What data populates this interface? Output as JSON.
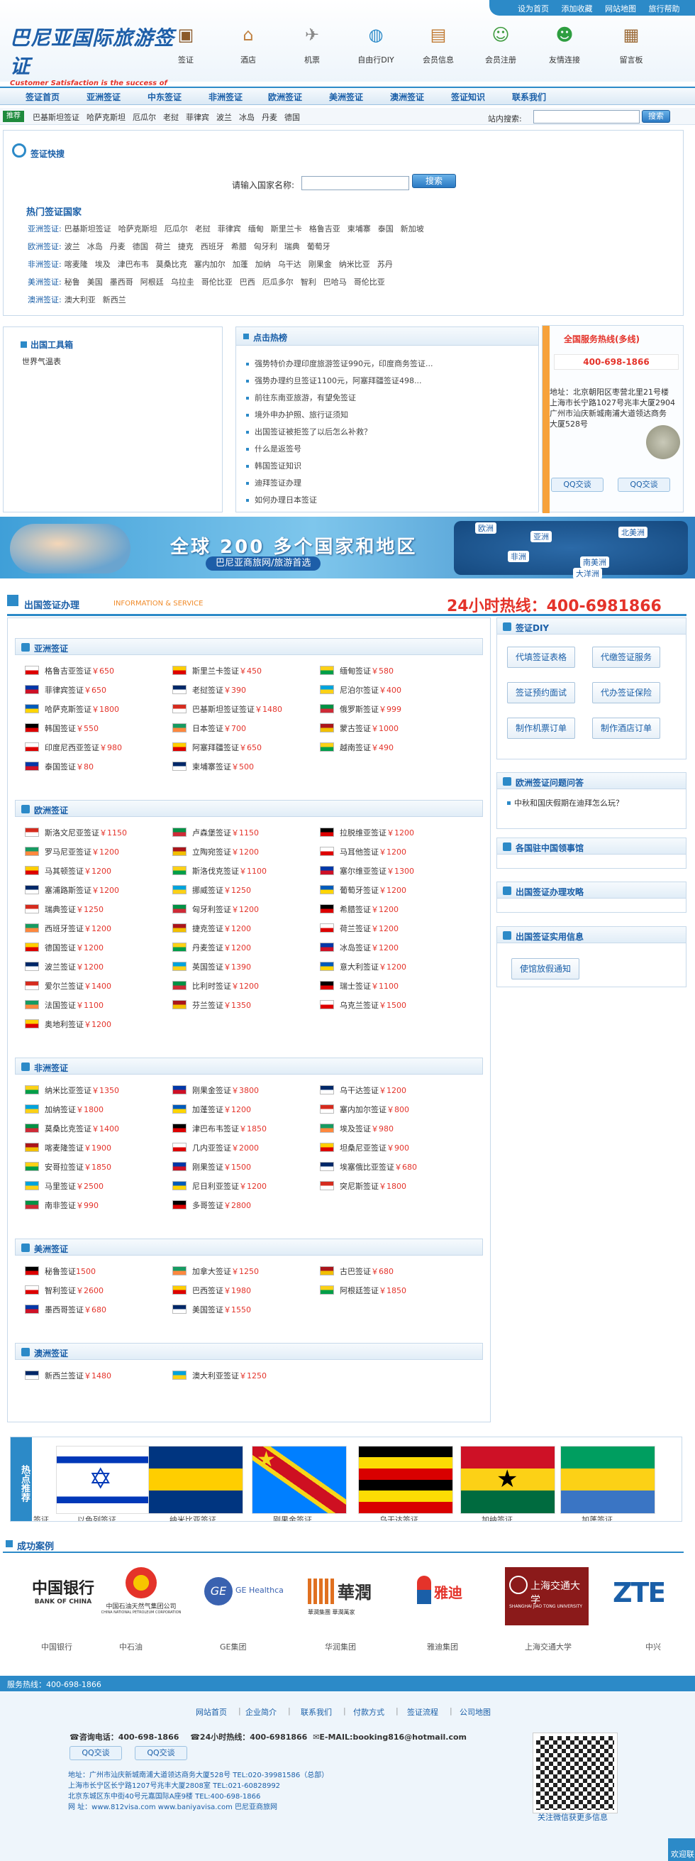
{
  "top_links": [
    "设为首页",
    "添加收藏",
    "网站地图",
    "旅行帮助"
  ],
  "logo": {
    "title": "巴尼亚国际旅游签证",
    "slogan": "Customer Satisfaction is the success of our business"
  },
  "top_icons": [
    {
      "label": "签证",
      "icon": "passport-icon",
      "color": "#8b5a2b",
      "glyph": "▣"
    },
    {
      "label": "酒店",
      "icon": "house-icon",
      "color": "#c08040",
      "glyph": "⌂"
    },
    {
      "label": "机票",
      "icon": "airplane-icon",
      "color": "#888888",
      "glyph": "✈"
    },
    {
      "label": "自由行DIY",
      "icon": "globe-icon",
      "color": "#2c8ac8",
      "glyph": "◍"
    },
    {
      "label": "会员信息",
      "icon": "sign-icon",
      "color": "#c07830",
      "glyph": "▤"
    },
    {
      "label": "会员注册",
      "icon": "user-add-icon",
      "color": "#3c9a3c",
      "glyph": "☺"
    },
    {
      "label": "友情连接",
      "icon": "people-icon",
      "color": "#2e9e40",
      "glyph": "☻"
    },
    {
      "label": "留言板",
      "icon": "board-icon",
      "color": "#9c6a36",
      "glyph": "▦"
    }
  ],
  "nav": [
    "签证首页",
    "亚洲签证",
    "中东签证",
    "非洲签证",
    "欧洲签证",
    "美洲签证",
    "澳洲签证",
    "签证知识",
    "联系我们"
  ],
  "sub": {
    "tag": "推荐",
    "links": [
      "巴基斯坦签证",
      "哈萨克斯坦",
      "厄瓜尔",
      "老挝",
      "菲律宾",
      "波兰",
      "冰岛",
      "丹麦",
      "德国"
    ],
    "search_label": "站内搜索:",
    "search_btn": "搜索"
  },
  "quick": {
    "title": "签证快搜",
    "label": "请输入国家名称:",
    "btn": "搜索",
    "hot_title": "热门签证国家",
    "lines": [
      {
        "head": "亚洲签证:",
        "items": [
          "巴基斯坦签证",
          "哈萨克斯坦",
          "厄瓜尔",
          "老挝",
          "菲律宾",
          "缅甸",
          "斯里兰卡",
          "格鲁吉亚",
          "柬埔寨",
          "泰国",
          "新加坡"
        ]
      },
      {
        "head": "欧洲签证:",
        "items": [
          "波兰",
          "冰岛",
          "丹麦",
          "德国",
          "荷兰",
          "捷克",
          "西班牙",
          "希腊",
          "匈牙利",
          "瑞典",
          "葡萄牙"
        ]
      },
      {
        "head": "非洲签证:",
        "items": [
          "喀麦隆",
          "埃及",
          "津巴布韦",
          "莫桑比克",
          "塞内加尔",
          "加蓬",
          "加纳",
          "乌干达",
          "刚果金",
          "纳米比亚",
          "苏丹"
        ]
      },
      {
        "head": "美洲签证:",
        "items": [
          "秘鲁",
          "美国",
          "墨西哥",
          "阿根廷",
          "乌拉圭",
          "哥伦比亚",
          "巴西",
          "厄瓜多尔",
          "智利",
          "巴哈马",
          "哥伦比亚"
        ]
      },
      {
        "head": "澳洲签证:",
        "items": [
          "澳大利亚",
          "新西兰"
        ]
      }
    ]
  },
  "tools": {
    "title": "出国工具箱",
    "item": "世界气温表"
  },
  "hot": {
    "title": "点击热榜",
    "items": [
      "强势特价办理印度旅游签证990元，印度商务签证...",
      "强势办理约旦签证1100元，阿塞拜疆签证498...",
      "前往东南亚旅游，有望免签证",
      "境外申办护照、旅行证须知",
      "出国签证被拒签了以后怎么补救？",
      "什么是返签号",
      "韩国签证知识",
      "迪拜签证办理",
      "如何办理日本签证"
    ]
  },
  "service": {
    "title": "全国服务热线(多线)",
    "phone": "400-698-1866",
    "addr": [
      "地址：北京朝阳区枣营北里21号楼",
      "上海市长宁路1027号兆丰大厦2904",
      "广州市汕庆新城南浦大道领达商务",
      "大厦528号"
    ],
    "qq": [
      "QQ交谈",
      "QQ交谈"
    ]
  },
  "banner": {
    "title": "全球 200 多个国家和地区",
    "sub": "巴尼亚商旅网/旅游首选",
    "continents": [
      "欧洲",
      "亚洲",
      "北美洲",
      "非洲",
      "南美洲",
      "大洋洲"
    ]
  },
  "visa_section": {
    "title": "出国签证办理",
    "en": "INFORMATION & SERVICE",
    "hotline": "24小时热线：400-6981866"
  },
  "regions": [
    {
      "name": "亚洲签证",
      "items": [
        [
          "格鲁吉亚签证",
          "￥650"
        ],
        [
          "斯里兰卡签证",
          "￥450"
        ],
        [
          "缅甸签证",
          "￥580"
        ],
        [
          "菲律宾签证",
          "￥650"
        ],
        [
          "老挝签证",
          "￥390"
        ],
        [
          "尼泊尔签证",
          "￥400"
        ],
        [
          "哈萨克斯签证",
          "￥1800"
        ],
        [
          "巴基斯坦签证签证",
          "￥1480"
        ],
        [
          "俄罗斯签证",
          "￥999"
        ],
        [
          "韩国签证",
          "￥550"
        ],
        [
          "日本签证",
          "￥700"
        ],
        [
          "蒙古签证",
          "￥1000"
        ],
        [
          "印度尼西亚签证",
          "￥980"
        ],
        [
          "阿塞拜疆签证",
          "￥650"
        ],
        [
          "越南签证",
          "￥490"
        ],
        [
          "泰国签证",
          "￥80"
        ],
        [
          "柬埔寨签证",
          "￥500"
        ]
      ]
    },
    {
      "name": "欧洲签证",
      "items": [
        [
          "斯洛文尼亚签证",
          "￥1150"
        ],
        [
          "卢森堡签证",
          "￥1150"
        ],
        [
          "拉脱维亚签证",
          "￥1200"
        ],
        [
          "罗马尼亚签证",
          "￥1200"
        ],
        [
          "立陶宛签证",
          "￥1200"
        ],
        [
          "马耳他签证",
          "￥1200"
        ],
        [
          "马其顿签证",
          "￥1200"
        ],
        [
          "斯洛伐克签证",
          "￥1100"
        ],
        [
          "塞尔维亚签证",
          "￥1300"
        ],
        [
          "塞浦路斯签证",
          "￥1200"
        ],
        [
          "挪威签证",
          "￥1250"
        ],
        [
          "葡萄牙签证",
          "￥1200"
        ],
        [
          "瑞典签证",
          "￥1250"
        ],
        [
          "匈牙利签证",
          "￥1200"
        ],
        [
          "希腊签证",
          "￥1200"
        ],
        [
          "西班牙签证",
          "￥1200"
        ],
        [
          "捷克签证",
          "￥1200"
        ],
        [
          "荷兰签证",
          "￥1200"
        ],
        [
          "德国签证",
          "￥1200"
        ],
        [
          "丹麦签证",
          "￥1200"
        ],
        [
          "冰岛签证",
          "￥1200"
        ],
        [
          "波兰签证",
          "￥1200"
        ],
        [
          "英国签证",
          "￥1390"
        ],
        [
          "意大利签证",
          "￥1200"
        ],
        [
          "爱尔兰签证",
          "￥1400"
        ],
        [
          "比利时签证",
          "￥1200"
        ],
        [
          "瑞士签证",
          "￥1100"
        ],
        [
          "法国签证",
          "￥1100"
        ],
        [
          "芬兰签证",
          "￥1350"
        ],
        [
          "乌克兰签证",
          "￥1500"
        ],
        [
          "奥地利签证",
          "￥1200"
        ]
      ]
    },
    {
      "name": "非洲签证",
      "items": [
        [
          "纳米比亚签证",
          "￥1350"
        ],
        [
          "刚果金签证",
          "￥3800"
        ],
        [
          "乌干达签证",
          "￥1200"
        ],
        [
          "加纳签证",
          "￥1800"
        ],
        [
          "加蓬签证",
          "￥1200"
        ],
        [
          "塞内加尔签证",
          "￥800"
        ],
        [
          "莫桑比克签证",
          "￥1400"
        ],
        [
          "津巴布韦签证",
          "￥1850"
        ],
        [
          "埃及签证",
          "￥980"
        ],
        [
          "喀麦隆签证",
          "￥1900"
        ],
        [
          "几内亚签证",
          "￥2000"
        ],
        [
          "坦桑尼亚签证",
          "￥900"
        ],
        [
          "安哥拉签证",
          "￥1850"
        ],
        [
          "刚果签证",
          "￥1500"
        ],
        [
          "埃塞俄比亚签证",
          "￥680"
        ],
        [
          "马里签证",
          "￥2500"
        ],
        [
          "尼日利亚签证",
          "￥1200"
        ],
        [
          "突尼斯签证",
          "￥1800"
        ],
        [
          "南非签证",
          "￥990"
        ],
        [
          "多哥签证",
          "￥2800"
        ]
      ]
    },
    {
      "name": "美洲签证",
      "items": [
        [
          "秘鲁签证",
          "1500"
        ],
        [
          "加拿大签证",
          "￥1250"
        ],
        [
          "古巴签证",
          "￥680"
        ],
        [
          "智利签证",
          "￥2600"
        ],
        [
          "巴西签证",
          "￥1980"
        ],
        [
          "阿根廷签证",
          "￥1850"
        ],
        [
          "墨西哥签证",
          "￥680"
        ],
        [
          "美国签证",
          "￥1550"
        ]
      ]
    },
    {
      "name": "澳洲签证",
      "items": [
        [
          "新西兰签证",
          "￥1480"
        ],
        [
          "澳大利亚签证",
          "￥1250"
        ]
      ]
    }
  ],
  "diy": {
    "title": "签证DIY",
    "buttons": [
      "代填签证表格",
      "代缴签证服务",
      "签证预约面试",
      "代办签证保险",
      "制作机票订单",
      "制作酒店订单"
    ]
  },
  "faq": {
    "title": "欧洲签证问题问答",
    "item": "中秋和国庆假期在迪拜怎么玩？"
  },
  "side_titles": [
    "各国驻中国领事馆",
    "出国签证办理攻略",
    "出国签证实用信息"
  ],
  "side_link": "使馆放假通知",
  "hot_rec": {
    "label": "热点推荐",
    "items": [
      "签证",
      "以色列签证",
      "纳米比亚签证",
      "刚果金签证",
      "乌干达签证",
      "加纳签证",
      "加蓬签证"
    ]
  },
  "cases": {
    "title": "成功案例",
    "items": [
      "中国银行",
      "中石油",
      "GE集团",
      "华润集团",
      "雅迪集团",
      "上海交通大学",
      "中兴"
    ],
    "logos": {
      "boc": "中国银行",
      "boc_en": "BANK OF CHINA",
      "cnpc": "中国石油天然气集团公司",
      "cnpc_en": "CHINA NATIONAL PETROLEUM CORPORATION",
      "ge": "GE Healthcare",
      "cr": "華潤",
      "cr_en": "華潤集團 華潤萬家",
      "yadi": "雅迪",
      "sjtu": "上海交通大学",
      "sjtu_en": "SHANGHAI JIAO TONG UNIVERSITY",
      "zte": "ZTE"
    }
  },
  "footer": {
    "hotline": "服务热线：400-698-1866",
    "links": [
      "网站首页",
      "企业简介",
      "联系我们",
      "付款方式",
      "签证流程",
      "公司地图"
    ],
    "c1": "咨询电话：400-698-1866",
    "c2": "24小时热线：400-6981866",
    "c3": "E-MAIL:booking816@hotmail.com",
    "qq": [
      "QQ交谈",
      "QQ交谈"
    ],
    "addr": [
      "地址：广州市汕庆新城南浦大道领达商务大厦528号 TEL:020-39981586（总部）",
      "上海市长宁区长宁路1207号兆丰大厦2808室 TEL:021-60828992",
      "北京东城区东中街40号元嘉国际A座9楼 TEL:400-698-1866",
      "网 址：www.812visa.com www.baniyavisa.com 巴尼亚商旅网"
    ],
    "qr_label": "关注微信获更多信息",
    "corner": "欢迎联"
  },
  "colors": {
    "brand": "#1a5fa8",
    "accent": "#2c8ac8",
    "price": "#e4332a"
  }
}
